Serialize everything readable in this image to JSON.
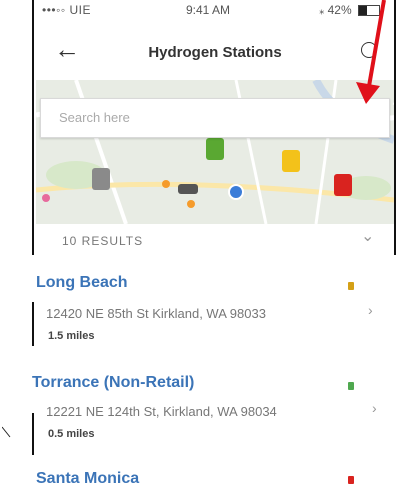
{
  "status_bar": {
    "carrier": "•••◦◦ UIE",
    "time": "9:41 AM",
    "battery": "42%"
  },
  "header": {
    "back_icon": "back-arrow-icon",
    "title": "Hydrogen Stations",
    "info_icon": "info-icon"
  },
  "search": {
    "placeholder": "Search here"
  },
  "map": {
    "pin_colors": [
      "#8a8a8a",
      "#5aa832",
      "#f3c21a",
      "#d9231f"
    ],
    "user_location_color": "#3b7dd8"
  },
  "results": {
    "count_label": "10 RESULTS",
    "items": [
      {
        "name": "Long Beach",
        "address": "12420 NE 85th St Kirkland, WA 98033",
        "distance": "1.5 miles",
        "status_color": "#d4a017"
      },
      {
        "name": "Torrance (Non-Retail)",
        "address": "12221 NE 124th St, Kirkland, WA 98034",
        "distance": "0.5 miles",
        "status_color": "#4fa84f"
      },
      {
        "name": "Santa Monica",
        "address": "",
        "distance": "",
        "status_color": "#d9231f"
      }
    ]
  },
  "annotation": {
    "arrow_color": "#e0101a"
  }
}
